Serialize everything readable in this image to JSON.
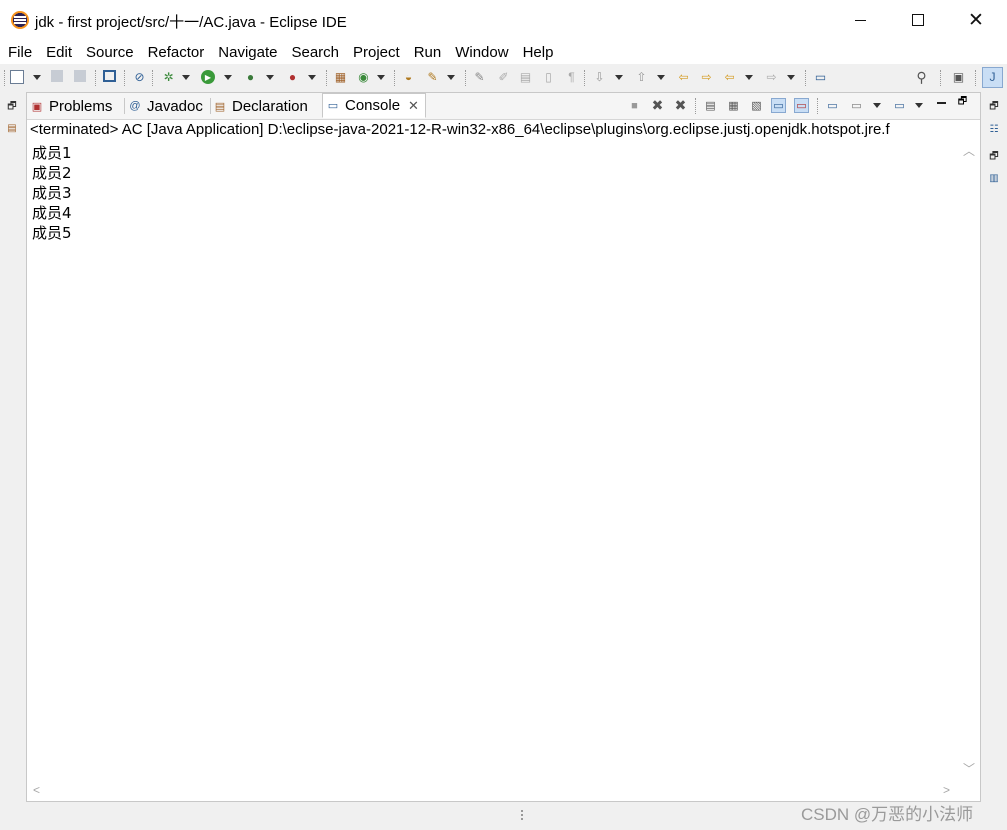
{
  "window": {
    "title": "jdk - first project/src/十一/AC.java - Eclipse IDE",
    "minimize_glyph": "",
    "close_glyph": "✕"
  },
  "menu": [
    "File",
    "Edit",
    "Source",
    "Refactor",
    "Navigate",
    "Search",
    "Project",
    "Run",
    "Window",
    "Help"
  ],
  "toolbar_icons": [
    "new-icon",
    "save-icon",
    "save-all-icon",
    "terminal-icon",
    "skip-breakpoints-icon",
    "debug-icon",
    "run-icon",
    "coverage-icon",
    "external-tools-icon",
    "new-java-project-icon",
    "new-class-icon",
    "open-type-icon",
    "search-icon",
    "toggle-mark-occurrences-icon",
    "toggle-block-selection-icon",
    "show-whitespace-icon",
    "next-annotation-icon",
    "previous-annotation-icon",
    "last-edit-location-icon",
    "back-icon",
    "forward-icon",
    "pin-editor-icon",
    "quick-access-icon",
    "open-perspective-icon",
    "java-perspective-icon"
  ],
  "tabs": [
    {
      "label": "Problems",
      "icon": "problems-icon",
      "active": false
    },
    {
      "label": "Javadoc",
      "icon": "javadoc-icon",
      "active": false
    },
    {
      "label": "Declaration",
      "icon": "declaration-icon",
      "active": false
    },
    {
      "label": "Console",
      "icon": "console-icon",
      "active": true
    }
  ],
  "console": {
    "status": "<terminated> AC [Java Application] D:\\eclipse-java-2021-12-R-win32-x86_64\\eclipse\\plugins\\org.eclipse.justj.openjdk.hotspot.jre.f",
    "lines": [
      "成员1",
      "成员2",
      "成员3",
      "成员4",
      "成员5"
    ]
  },
  "watermark": "CSDN @万恶的小法师",
  "colors": {
    "accent": "#c9def5",
    "window_bg": "#f0f0f0",
    "view_bg": "#ffffff"
  }
}
